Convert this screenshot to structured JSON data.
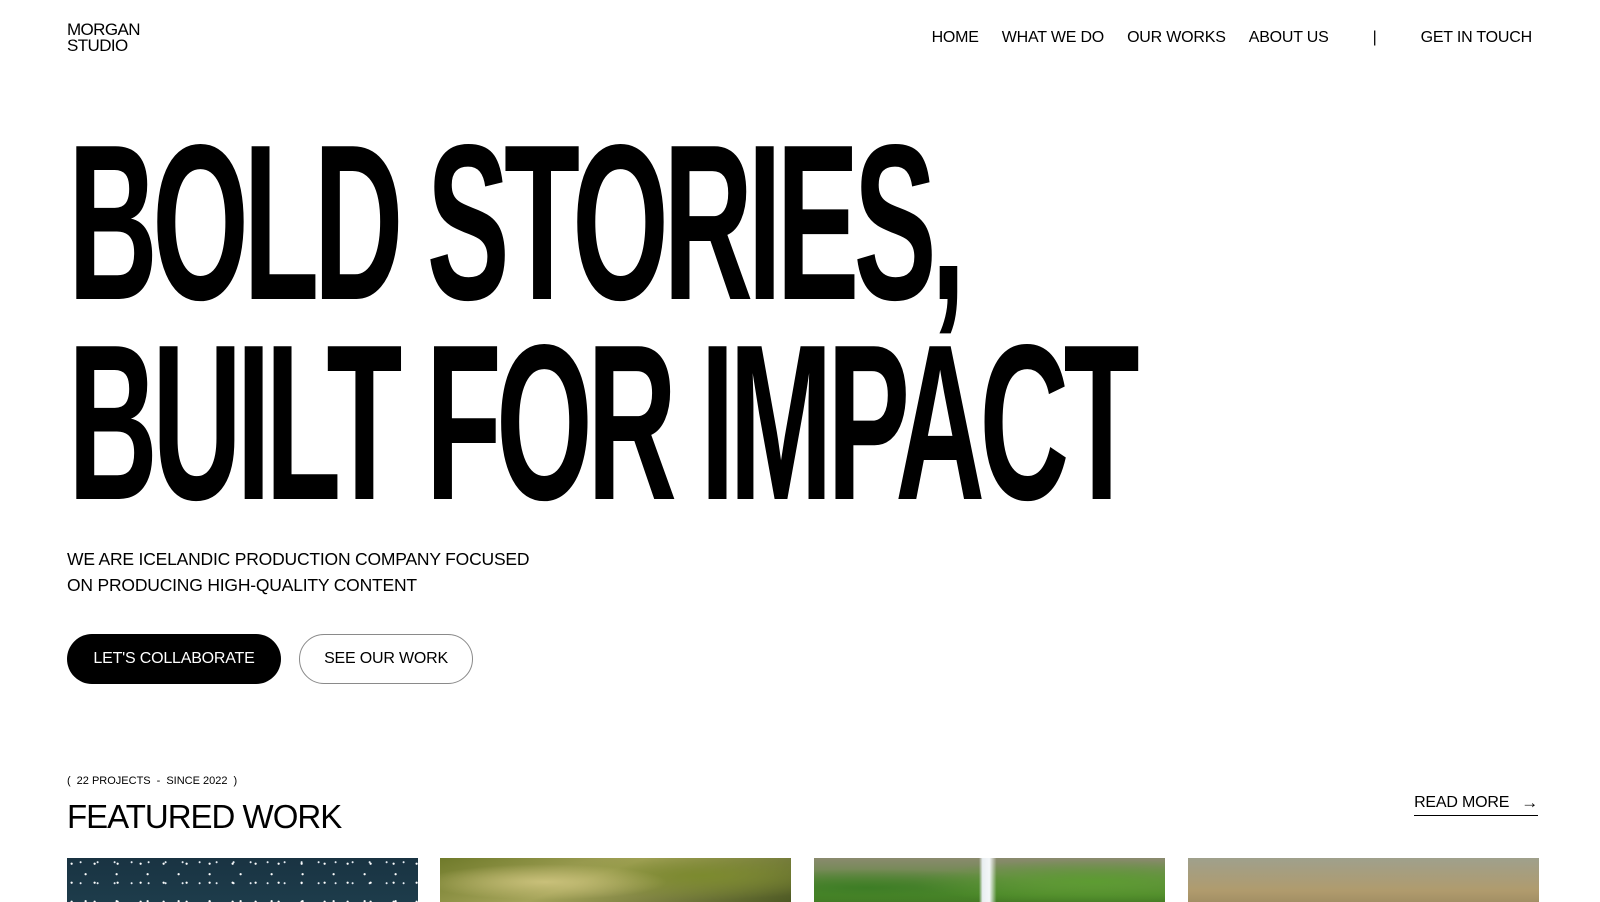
{
  "brand": {
    "line1": "MORGAN",
    "line2": "STUDIO"
  },
  "nav": {
    "items": [
      {
        "label": "HOME"
      },
      {
        "label": "WHAT WE DO"
      },
      {
        "label": "OUR WORKS"
      },
      {
        "label": "ABOUT US"
      }
    ],
    "divider": "|",
    "cta": "GET IN TOUCH"
  },
  "hero": {
    "line1": "BOLD STORIES,",
    "line2": "BUILT FOR IMPACT",
    "tagline_line1": "WE ARE ICELANDIC PRODUCTION COMPANY FOCUSED",
    "tagline_line2": "ON PRODUCING HIGH-QUALITY CONTENT",
    "primary_button": "LET'S COLLABORATE",
    "secondary_button": "SEE OUR WORK"
  },
  "featured": {
    "meta_open": "(",
    "meta_projects": "22 PROJECTS",
    "meta_separator": "-",
    "meta_since": "SINCE 2022",
    "meta_close": ")",
    "title": "FEATURED WORK",
    "read_more": "READ MORE",
    "read_more_arrow": "→",
    "thumbnails": [
      {
        "subject": "night-sky"
      },
      {
        "subject": "tree-canopy"
      },
      {
        "subject": "waterfall-forest"
      },
      {
        "subject": "misty-landscape"
      }
    ]
  }
}
